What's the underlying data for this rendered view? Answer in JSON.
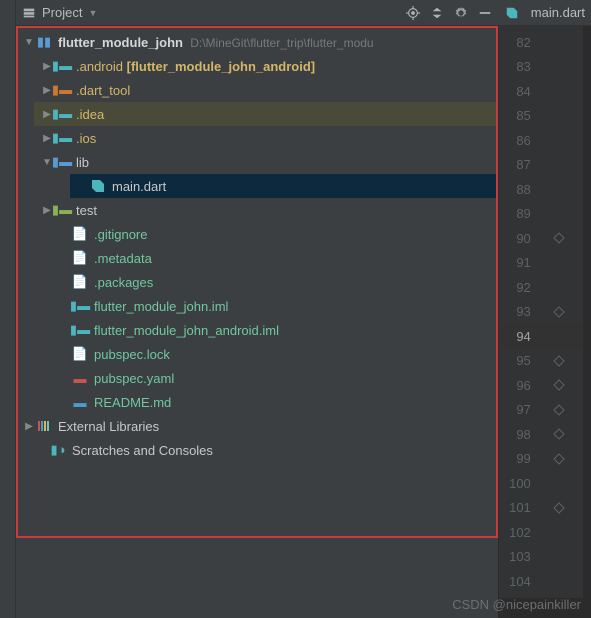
{
  "header": {
    "title": "Project",
    "tab_label": "main.dart"
  },
  "tree": {
    "root": {
      "name": "flutter_module_john",
      "path": "D:\\MineGit\\flutter_trip\\flutter_modu"
    },
    "android": {
      "name": ".android",
      "module": "[flutter_module_john_android]"
    },
    "dart_tool": ".dart_tool",
    "idea": ".idea",
    "ios": ".ios",
    "lib": "lib",
    "main_dart": "main.dart",
    "test": "test",
    "gitignore": ".gitignore",
    "metadata": ".metadata",
    "packages": ".packages",
    "iml1": "flutter_module_john.iml",
    "iml2": "flutter_module_john_android.iml",
    "pubspec_lock": "pubspec.lock",
    "pubspec_yaml": "pubspec.yaml",
    "readme": "README.md",
    "external_libs": "External Libraries",
    "scratches": "Scratches and Consoles"
  },
  "gutter": {
    "lines": [
      82,
      83,
      84,
      85,
      86,
      87,
      88,
      89,
      90,
      91,
      92,
      93,
      94,
      95,
      96,
      97,
      98,
      99,
      100,
      101,
      102,
      103,
      104
    ],
    "current": 94,
    "markers": {
      "90": "fold",
      "93": "fold-down",
      "95": "fold",
      "96": "fold",
      "97": "fold",
      "98": "fold",
      "99": "fold",
      "101": "fold"
    }
  },
  "watermark": "CSDN @nicepainkiller"
}
